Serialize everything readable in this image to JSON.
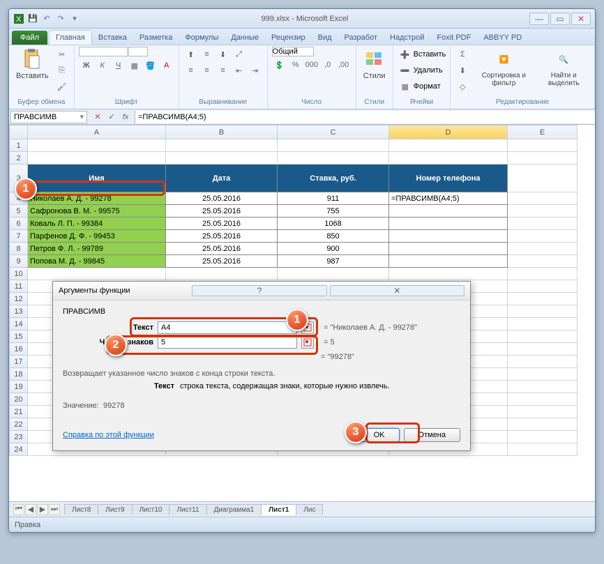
{
  "title": "999.xlsx - Microsoft Excel",
  "tabs": {
    "file": "Файл",
    "home": "Главная",
    "insert": "Вставка",
    "layout": "Разметка",
    "formulas": "Формулы",
    "data": "Данные",
    "review": "Рецензир",
    "view": "Вид",
    "dev": "Разработ",
    "add": "Надстрой",
    "foxit": "Foxit PDF",
    "abbyy": "ABBYY PD"
  },
  "ribbon": {
    "paste": "Вставить",
    "clipboard": "Буфер обмена",
    "font": "Шрифт",
    "align": "Выравнивание",
    "number": "Число",
    "numfmt": "Общий",
    "styles": "Стили",
    "styles_btn": "Стили",
    "cells": "Ячейки",
    "ins": "Вставить",
    "del": "Удалить",
    "fmt": "Формат",
    "editing": "Редактирование",
    "sort": "Сортировка и фильтр",
    "find": "Найти и выделить"
  },
  "name_box": "ПРАВСИМВ",
  "formula": "=ПРАВСИМВ(A4;5)",
  "cols": [
    "A",
    "B",
    "C",
    "D",
    "E"
  ],
  "headers": {
    "name": "Имя",
    "date": "Дата",
    "rate": "Ставка, руб.",
    "phone": "Номер телефона"
  },
  "rows": [
    {
      "n": "Николаев А. Д. - 99278",
      "d": "25.05.2016",
      "r": "911",
      "p": "=ПРАВСИМВ(A4;5)"
    },
    {
      "n": "Сафронова В. М. - 99575",
      "d": "25.05.2016",
      "r": "755",
      "p": ""
    },
    {
      "n": "Коваль Л. П. - 99384",
      "d": "25.05.2016",
      "r": "1068",
      "p": ""
    },
    {
      "n": "Парфенов Д. Ф. - 99453",
      "d": "25.05.2016",
      "r": "850",
      "p": ""
    },
    {
      "n": "Петров Ф. Л. - 99789",
      "d": "25.05.2016",
      "r": "900",
      "p": ""
    },
    {
      "n": "Попова М. Д. - 99845",
      "d": "25.05.2016",
      "r": "987",
      "p": ""
    }
  ],
  "dialog": {
    "title": "Аргументы функции",
    "fn": "ПРАВСИМВ",
    "arg1_label": "Текст",
    "arg1_val": "A4",
    "arg1_res": "\"Николаев А. Д. - 99278\"",
    "arg2_label": "Число_знаков",
    "arg2_val": "5",
    "arg2_res": "5",
    "fn_res": "\"99278\"",
    "desc": "Возвращает указанное число знаков с конца строки текста.",
    "arg_name": "Текст",
    "arg_desc": "строка текста, содержащая знаки, которые нужно извлечь.",
    "result_label": "Значение:",
    "result": "99278",
    "help": "Справка по этой функции",
    "ok": "OK",
    "cancel": "Отмена"
  },
  "sheets": [
    "Лист8",
    "Лист9",
    "Лист10",
    "Лист11",
    "Диаграмма1",
    "Лист1",
    "Лис"
  ],
  "active_sheet": 5,
  "status": "Правка",
  "callouts": {
    "c1": "1",
    "c2": "2",
    "c3": "3",
    "d1": "1",
    "d2": "2",
    "d3": "3"
  }
}
